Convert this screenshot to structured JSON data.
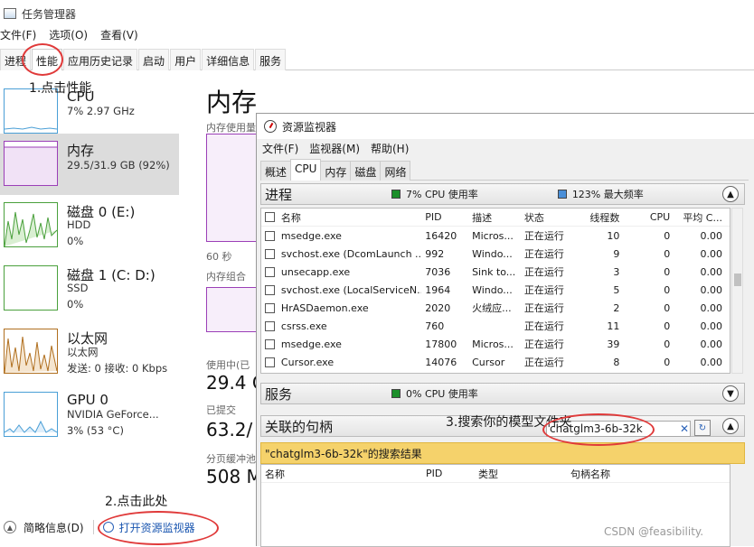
{
  "task_manager": {
    "title": "任务管理器",
    "menu": [
      "文件(F)",
      "选项(O)",
      "查看(V)"
    ],
    "tabs": [
      "进程",
      "性能",
      "应用历史记录",
      "启动",
      "用户",
      "详细信息",
      "服务"
    ],
    "sidebar": {
      "cpu": {
        "title": "CPU",
        "line1": "7% 2.97 GHz"
      },
      "memory": {
        "title": "内存",
        "line1": "29.5/31.9 GB (92%)"
      },
      "disk0": {
        "title": "磁盘 0 (E:)",
        "line1": "HDD",
        "line2": "0%"
      },
      "disk1": {
        "title": "磁盘 1 (C: D:)",
        "line1": "SSD",
        "line2": "0%"
      },
      "ethernet": {
        "title": "以太网",
        "line1": "以太网",
        "line2": "发送: 0 接收: 0 Kbps"
      },
      "gpu": {
        "title": "GPU 0",
        "line1": "NVIDIA GeForce...",
        "line2": "3% (53 °C)"
      }
    },
    "main": {
      "title": "内存",
      "usage_label": "内存使用量",
      "time_label": "60 秒",
      "composition_label": "内存组合",
      "in_use_label": "使用中(已",
      "in_use_value": "29.4 G",
      "committed_label": "已提交",
      "committed_value": "63.2/",
      "paged_label": "分页缓冲池",
      "paged_value": "508 M"
    },
    "bottom": {
      "fewer_details": "简略信息(D)",
      "open_resmon": "打开资源监视器"
    }
  },
  "annotations": {
    "step1": "1.点击性能",
    "step2": "2.点击此处",
    "step3": "3.搜索你的模型文件夹"
  },
  "resource_monitor": {
    "title": "资源监视器",
    "menu": [
      "文件(F)",
      "监视器(M)",
      "帮助(H)"
    ],
    "tabs": [
      "概述",
      "CPU",
      "内存",
      "磁盘",
      "网络"
    ],
    "processes": {
      "title": "进程",
      "legend_cpu": "7% CPU 使用率",
      "legend_freq": "123% 最大频率",
      "headers": [
        "名称",
        "PID",
        "描述",
        "状态",
        "线程数",
        "CPU",
        "平均 C..."
      ],
      "rows": [
        {
          "name": "msedge.exe",
          "pid": "16420",
          "desc": "Micros...",
          "status": "正在运行",
          "threads": "10",
          "cpu": "0",
          "avg": "0.00"
        },
        {
          "name": "svchost.exe (DcomLaunch ...",
          "pid": "992",
          "desc": "Windo...",
          "status": "正在运行",
          "threads": "9",
          "cpu": "0",
          "avg": "0.00"
        },
        {
          "name": "unsecapp.exe",
          "pid": "7036",
          "desc": "Sink to...",
          "status": "正在运行",
          "threads": "3",
          "cpu": "0",
          "avg": "0.00"
        },
        {
          "name": "svchost.exe (LocalServiceN...",
          "pid": "1964",
          "desc": "Windo...",
          "status": "正在运行",
          "threads": "5",
          "cpu": "0",
          "avg": "0.00"
        },
        {
          "name": "HrASDaemon.exe",
          "pid": "2020",
          "desc": "火绒应...",
          "status": "正在运行",
          "threads": "2",
          "cpu": "0",
          "avg": "0.00"
        },
        {
          "name": "csrss.exe",
          "pid": "760",
          "desc": "",
          "status": "正在运行",
          "threads": "11",
          "cpu": "0",
          "avg": "0.00"
        },
        {
          "name": "msedge.exe",
          "pid": "17800",
          "desc": "Micros...",
          "status": "正在运行",
          "threads": "39",
          "cpu": "0",
          "avg": "0.00"
        },
        {
          "name": "Cursor.exe",
          "pid": "14076",
          "desc": "Cursor",
          "status": "正在运行",
          "threads": "8",
          "cpu": "0",
          "avg": "0.00"
        }
      ]
    },
    "services": {
      "title": "服务",
      "legend_cpu": "0% CPU 使用率"
    },
    "handles": {
      "title": "关联的句柄",
      "search_value": "chatglm3-6b-32k",
      "results_label": "\"chatglm3-6b-32k\"的搜索结果",
      "headers": [
        "名称",
        "PID",
        "类型",
        "句柄名称"
      ]
    }
  },
  "watermark": "CSDN @feasibility."
}
